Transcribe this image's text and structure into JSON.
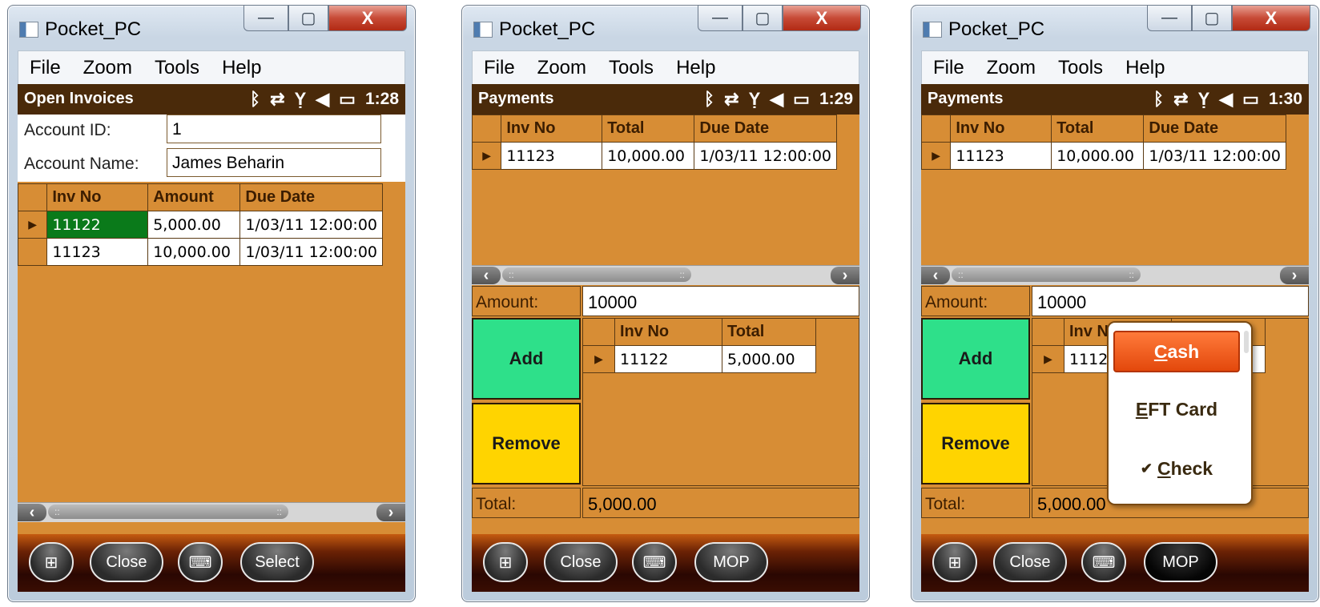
{
  "window_title": "Pocket_PC",
  "window_buttons": {
    "minimize": "—",
    "maximize": "▢",
    "close": "X"
  },
  "menu": [
    "File",
    "Zoom",
    "Tools",
    "Help"
  ],
  "status_icons": [
    "bluetooth-icon",
    "sync-icon",
    "no-signal-icon",
    "volume-icon",
    "battery-icon"
  ],
  "screens": [
    {
      "title": "Open Invoices",
      "time": "1:28",
      "account_id_label": "Account ID:",
      "account_id_value": "1",
      "account_name_label": "Account Name:",
      "account_name_value": "James Beharin",
      "grid": {
        "columns": [
          "Inv No",
          "Amount",
          "Due Date"
        ],
        "rows": [
          [
            "11122",
            "5,000.00",
            "1/03/11 12:00:00"
          ],
          [
            "11123",
            "10,000.00",
            "1/03/11 12:00:00"
          ]
        ]
      },
      "softkeys": [
        "Close",
        "Select"
      ]
    },
    {
      "title": "Payments",
      "time": "1:29",
      "grid": {
        "columns": [
          "Inv No",
          "Total",
          "Due Date"
        ],
        "rows": [
          [
            "11123",
            "10,000.00",
            "1/03/11 12:00:00"
          ]
        ]
      },
      "amount_label": "Amount:",
      "amount_value": "10000",
      "add_label": "Add",
      "remove_label": "Remove",
      "sub_grid": {
        "columns": [
          "Inv No",
          "Total"
        ],
        "rows": [
          [
            "11122",
            "5,000.00"
          ]
        ]
      },
      "total_label": "Total:",
      "total_value": "5,000.00",
      "softkeys": [
        "Close",
        "MOP"
      ]
    },
    {
      "title": "Payments",
      "time": "1:30",
      "grid": {
        "columns": [
          "Inv No",
          "Total",
          "Due Date"
        ],
        "rows": [
          [
            "11123",
            "10,000.00",
            "1/03/11 12:00:00"
          ]
        ]
      },
      "amount_label": "Amount:",
      "amount_value": "10000",
      "add_label": "Add",
      "remove_label": "Remove",
      "sub_grid": {
        "columns": [
          "Inv N"
        ],
        "rows": [
          [
            "1112"
          ]
        ]
      },
      "total_label": "Total:",
      "total_value": "5,000.00",
      "softkeys": [
        "Close",
        "MOP"
      ],
      "popup": {
        "items": [
          {
            "underline": "C",
            "rest": "ash",
            "active": true,
            "check": ""
          },
          {
            "underline": "E",
            "rest": "FT Card",
            "active": false,
            "check": ""
          },
          {
            "underline": "C",
            "rest": "heck",
            "active": false,
            "check": "✔"
          }
        ]
      }
    }
  ]
}
